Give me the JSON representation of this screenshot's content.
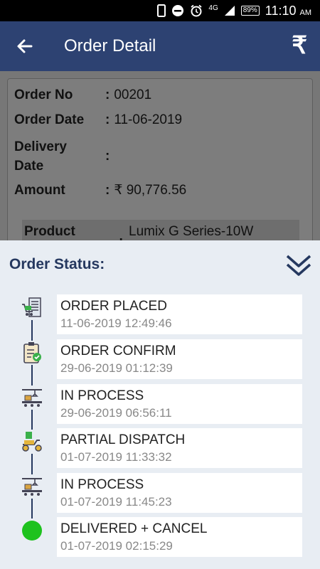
{
  "status_bar": {
    "network": "4G",
    "battery": "89%",
    "time": "11:10",
    "ampm": "AM"
  },
  "app_bar": {
    "title": "Order Detail",
    "rupee": "₹"
  },
  "order": {
    "order_no_label": "Order No",
    "order_no": "00201",
    "order_date_label": "Order Date",
    "order_date": "11-06-2019",
    "delivery_label_1": "Delivery",
    "delivery_label_2": "Date",
    "delivery_date": "",
    "amount_label": "Amount",
    "amount": "₹ 90,776.56",
    "product_label": "Product",
    "product_value": "Lumix G Series-10W"
  },
  "sheet": {
    "title": "Order Status:",
    "steps": [
      {
        "name": "ORDER PLACED",
        "time": "11-06-2019 12:49:46",
        "icon": "cart-list-icon"
      },
      {
        "name": "ORDER CONFIRM",
        "time": "29-06-2019 01:12:39",
        "icon": "clipboard-check-icon"
      },
      {
        "name": "IN PROCESS",
        "time": "29-06-2019 06:56:11",
        "icon": "conveyor-icon"
      },
      {
        "name": "PARTIAL DISPATCH",
        "time": "01-07-2019 11:33:32",
        "icon": "scooter-delivery-icon"
      },
      {
        "name": "IN PROCESS",
        "time": "01-07-2019 11:45:23",
        "icon": "conveyor-icon"
      },
      {
        "name": "DELIVERED + CANCEL",
        "time": "01-07-2019 02:15:29",
        "icon": "green-dot-icon"
      }
    ]
  },
  "colors": {
    "app_bar": "#2d4272",
    "accent": "#25385f",
    "delivered": "#1ec21e"
  }
}
